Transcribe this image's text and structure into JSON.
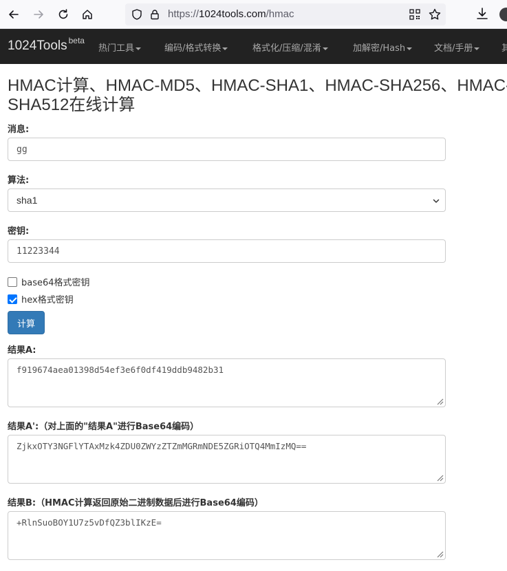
{
  "browser": {
    "url_prefix": "https://",
    "url_domain": "1024tools.com",
    "url_path": "/hmac"
  },
  "navbar": {
    "brand": "1024Tools",
    "brand_sup": "beta",
    "menu": [
      {
        "label": "热门工具"
      },
      {
        "label": "编码/格式转换"
      },
      {
        "label": "格式化/压缩/混淆"
      },
      {
        "label": "加解密/Hash"
      },
      {
        "label": "文档/手册"
      },
      {
        "label": "其"
      }
    ]
  },
  "page": {
    "title": "HMAC计算、HMAC-MD5、HMAC-SHA1、HMAC-SHA256、HMAC-SHA512在线计算"
  },
  "form": {
    "message_label": "消息:",
    "message_value": "gg",
    "algorithm_label": "算法:",
    "algorithm_value": "sha1",
    "key_label": "密钥:",
    "key_value": "11223344",
    "base64_key_label": "base64格式密钥",
    "base64_key_checked": false,
    "hex_key_label": "hex格式密钥",
    "hex_key_checked": true,
    "calc_button": "计算"
  },
  "results": {
    "a_label": "结果A:",
    "a_value": "f919674aea01398d54ef3e6f0df419ddb9482b31",
    "a2_label": "结果A':（对上面的\"结果A\"进行Base64编码）",
    "a2_value": "ZjkxOTY3NGFlYTAxMzk4ZDU0ZWYzZTZmMGRmNDE5ZGRiOTQ4MmIzMQ==",
    "b_label": "结果B:（HMAC计算返回原始二进制数据后进行Base64编码）",
    "b_value": "+RlnSuoBOY1U7z5vDfQZ3blIKzE="
  }
}
